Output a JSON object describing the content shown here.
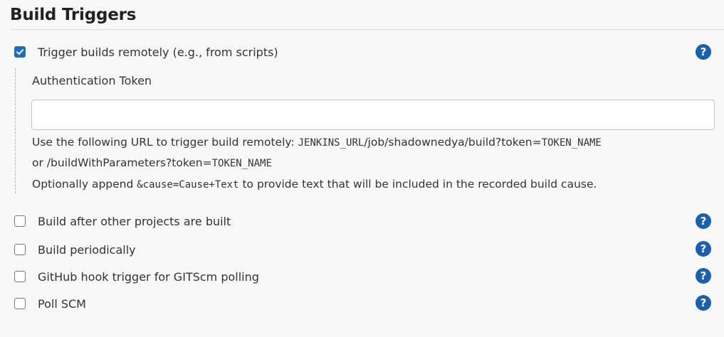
{
  "section": {
    "title": "Build Triggers"
  },
  "remote": {
    "label": "Trigger builds remotely (e.g., from scripts)",
    "checked": true,
    "token_label": "Authentication Token",
    "token_value": "",
    "url_prefix": "Use the following URL to trigger build remotely: ",
    "url_code": "JENKINS_URL",
    "url_path": "/job/shadownedya/build?token=",
    "url_token": "TOKEN_NAME",
    "line2_prefix": "or /buildWithParameters?token=",
    "line2_token": "TOKEN_NAME",
    "line3_prefix": "Optionally append ",
    "line3_code": "&cause=Cause+Text",
    "line3_suffix": " to provide text that will be included in the recorded build cause."
  },
  "triggers": [
    {
      "label": "Build after other projects are built",
      "checked": false
    },
    {
      "label": "Build periodically",
      "checked": false
    },
    {
      "label": "GitHub hook trigger for GITScm polling",
      "checked": false
    },
    {
      "label": "Poll SCM",
      "checked": false
    }
  ],
  "help_glyph": "?",
  "colors": {
    "accent": "#1c6ec1",
    "help": "#1b5fb0"
  }
}
